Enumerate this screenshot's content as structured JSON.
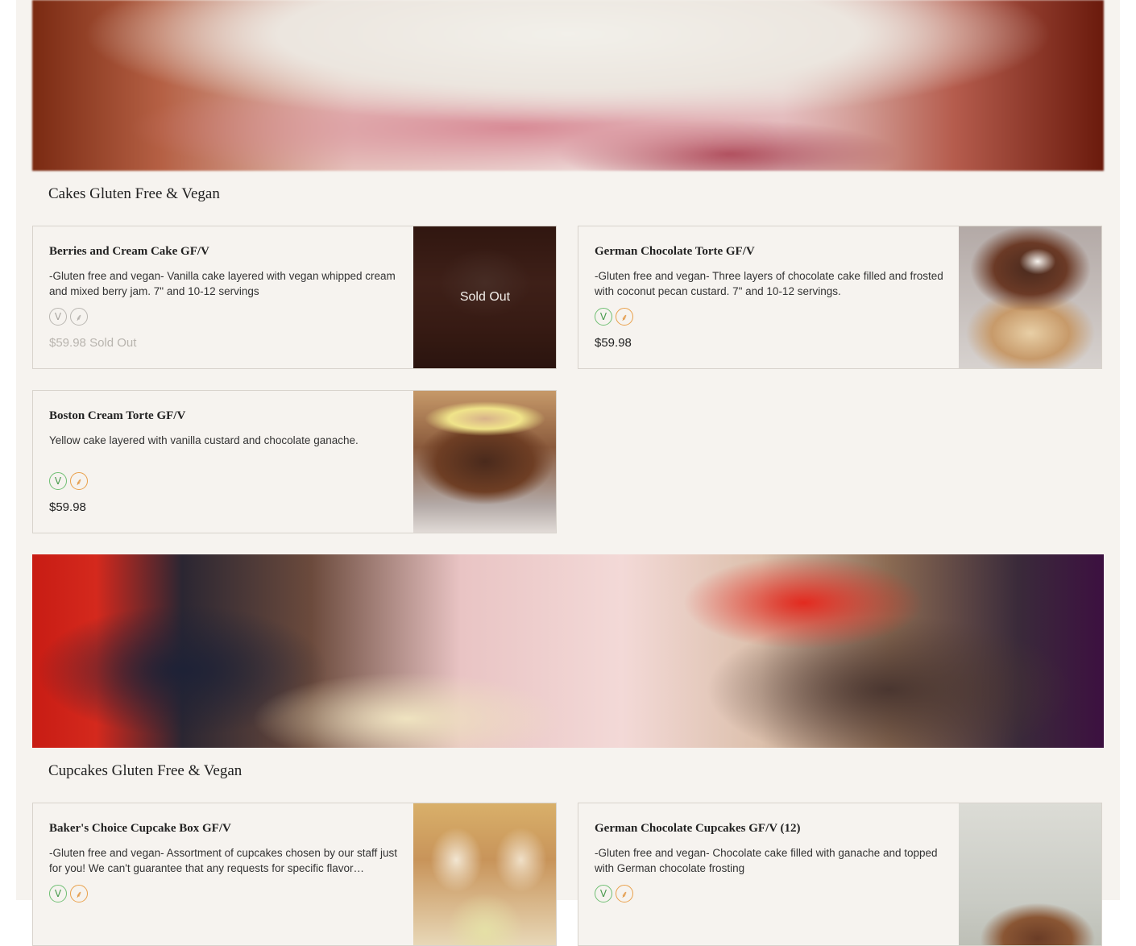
{
  "sections": [
    {
      "title": "Cakes Gluten Free & Vegan",
      "items": [
        {
          "name": "Berries and Cream Cake GF/V",
          "description": "-Gluten free and vegan- Vanilla cake layered with vegan whipped cream and mixed berry jam. 7\" and 10-12 servings",
          "price": "$59.98",
          "status": "Sold Out",
          "thumb_status": "Sold Out",
          "badges": [
            "vegan-icon",
            "gluten-free-icon"
          ]
        },
        {
          "name": "German Chocolate Torte GF/V",
          "description": "-Gluten free and vegan- Three layers of chocolate cake filled and frosted with coconut pecan custard. 7\" and 10-12 servings.",
          "price": "$59.98",
          "badges": [
            "vegan-icon",
            "gluten-free-icon"
          ]
        },
        {
          "name": "Boston Cream Torte GF/V",
          "description": "Yellow cake layered with vanilla custard and chocolate ganache.",
          "price": "$59.98",
          "badges": [
            "vegan-icon",
            "gluten-free-icon"
          ]
        }
      ]
    },
    {
      "title": "Cupcakes Gluten Free & Vegan",
      "items": [
        {
          "name": "Baker's Choice Cupcake Box GF/V",
          "description": "-Gluten free and vegan- Assortment of cupcakes chosen by our staff just for you! We can't guarantee that any requests for specific flavor…",
          "badges": [
            "vegan-icon",
            "gluten-free-icon"
          ]
        },
        {
          "name": "German Chocolate Cupcakes GF/V (12)",
          "description": "-Gluten free and vegan- Chocolate cake filled with ganache and topped with German chocolate frosting",
          "badges": [
            "vegan-icon",
            "gluten-free-icon"
          ]
        }
      ]
    }
  ],
  "badge_glyphs": {
    "vegan": "V",
    "gluten_free": "⸙"
  },
  "colors": {
    "background": "#f6f3ef",
    "vegan_badge": "#6fbf73",
    "gluten_free_badge": "#e9a04a",
    "disabled": "#b8b4ae"
  }
}
